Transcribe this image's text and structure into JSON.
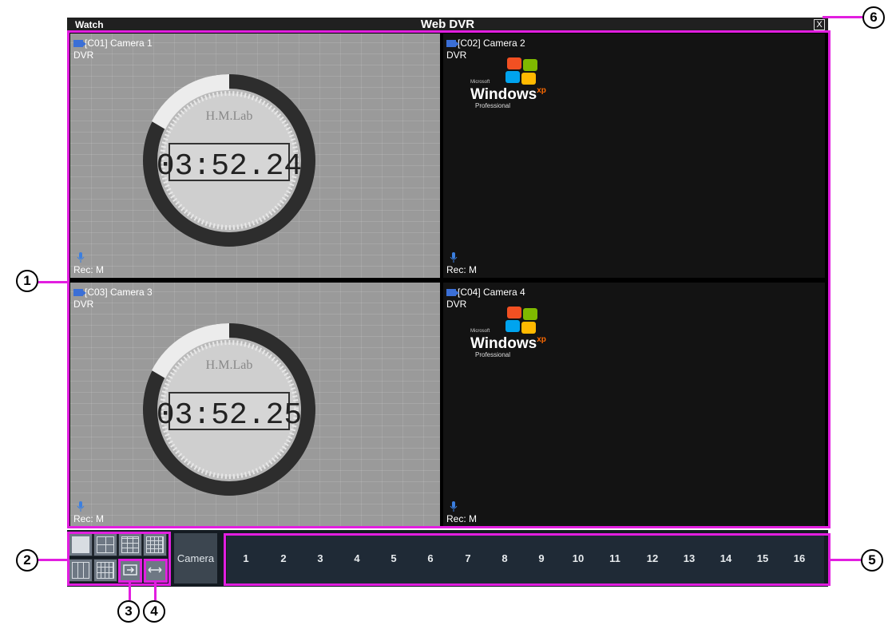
{
  "window": {
    "left_title": "Watch",
    "title": "Web DVR",
    "close_label": "X"
  },
  "cameras": [
    {
      "label": "[C01] Camera 1",
      "source": "DVR",
      "rec": "Rec: M",
      "clock": "03:52.24",
      "clock_brand": "H.M.Lab"
    },
    {
      "label": "[C02] Camera 2",
      "source": "DVR",
      "rec": "Rec: M",
      "logo_brand": "Microsoft",
      "logo_word": "Windows",
      "logo_sup": "xp",
      "logo_edition": "Professional"
    },
    {
      "label": "[C03] Camera 3",
      "source": "DVR",
      "rec": "Rec: M",
      "clock": "03:52.25",
      "clock_brand": "H.M.Lab"
    },
    {
      "label": "[C04] Camera 4",
      "source": "DVR",
      "rec": "Rec: M",
      "logo_brand": "Microsoft",
      "logo_word": "Windows",
      "logo_sup": "xp",
      "logo_edition": "Professional"
    }
  ],
  "toolbar": {
    "camera_tab": "Camera",
    "channels": [
      "1",
      "2",
      "3",
      "4",
      "5",
      "6",
      "7",
      "8",
      "9",
      "10",
      "11",
      "12",
      "13",
      "14",
      "15",
      "16"
    ],
    "layout_buttons": [
      "layout-1x1",
      "layout-2x2",
      "layout-3x3",
      "layout-4x4",
      "layout-1+5",
      "layout-1+7",
      "sequence",
      "fullscreen"
    ]
  },
  "callouts": [
    "1",
    "2",
    "3",
    "4",
    "5",
    "6"
  ],
  "colors": {
    "highlight": "#e21ee0",
    "toolbar_bg": "#141b22",
    "channel_bar_bg": "#1f2a36"
  }
}
